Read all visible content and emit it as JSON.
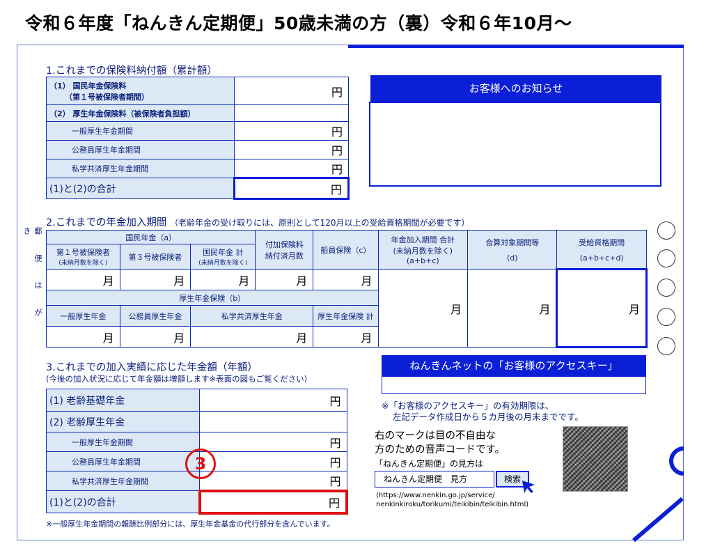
{
  "title": "令和６年度「ねんきん定期便」50歳未満の方（裏）令和６年10月～",
  "sec1": {
    "heading": "1.これまでの保険料納付額（累計額）",
    "r1a": "（1） 国民年金保険料",
    "r1b": "（第１号被保険者期間）",
    "r2": "（2） 厚生年金保険料（被保険者負担額）",
    "r3": "一般厚生年金期間",
    "r4": "公務員厚生年金期間",
    "r5": "私学共済厚生年金期間",
    "total": "(1)と(2)の合計",
    "yen": "円"
  },
  "notice": {
    "heading": "お客様へのお知らせ"
  },
  "sec2": {
    "heading": "2.これまでの年金加入期間",
    "note": "（老齢年金の受け取りには、原則として120月以上の受給資格期間が必要です）",
    "kokumin": "国民年金（a）",
    "h1a": "第１号被保険者",
    "h1b": "(未納月数を除く)",
    "h2": "第３号被保険者",
    "h3a": "国民年金 計",
    "h3b": "(未納月数を除く)",
    "h4a": "付加保険料",
    "h4b": "納付済月数",
    "h5": "船員保険（c）",
    "h6a": "年金加入期間 合計",
    "h6b": "(未納月数を除く)",
    "h6c": "(a+b+c)",
    "h7a": "合算対象期間等",
    "h7b": "(d)",
    "h8a": "受給資格期間",
    "h8b": "(a+b+c+d)",
    "kosei": "厚生年金保険（b）",
    "k1": "一般厚生年金",
    "k2": "公務員厚生年金",
    "k3": "私学共済厚生年金",
    "k4": "厚生年金保険 計",
    "month": "月"
  },
  "side_vertical": "郵便はがき",
  "sec3": {
    "heading": "3.これまでの加入実績に応じた年金額（年額）",
    "sub": "(今後の加入状況に応じて年金額は増額します※表面の図もご覧ください)",
    "r1": "(1) 老齢基礎年金",
    "r2": "(2) 老齢厚生年金",
    "r3": "一般厚生年金期間",
    "r4": "公務員厚生年金期間",
    "r5": "私学共済厚生年金期間",
    "total": "(1)と(2)の合計",
    "footnote": "※一般厚生年金期間の報酬比例部分には、厚生年金基金の代行部分を含んでいます。",
    "yen": "円"
  },
  "accesskey": {
    "heading": "ねんきんネットの「お客様のアクセスキー」",
    "note1": "※「お客様のアクセスキー」の有効期限は、",
    "note2": "左記データ作成日から５カ月後の月末までです。"
  },
  "voice": {
    "l1": "右のマークは目の不自由な",
    "l2": "方のための音声コードです。",
    "l3": "「ねんきん定期便」の見方は",
    "search_value": "ねんきん定期便　見方",
    "search_btn": "検索",
    "url1": "(https://www.nenkin.go.jp/service/",
    "url2": "nenkinkiroku/torikumi/teikibin/teikibin.html)"
  },
  "marker": "3"
}
